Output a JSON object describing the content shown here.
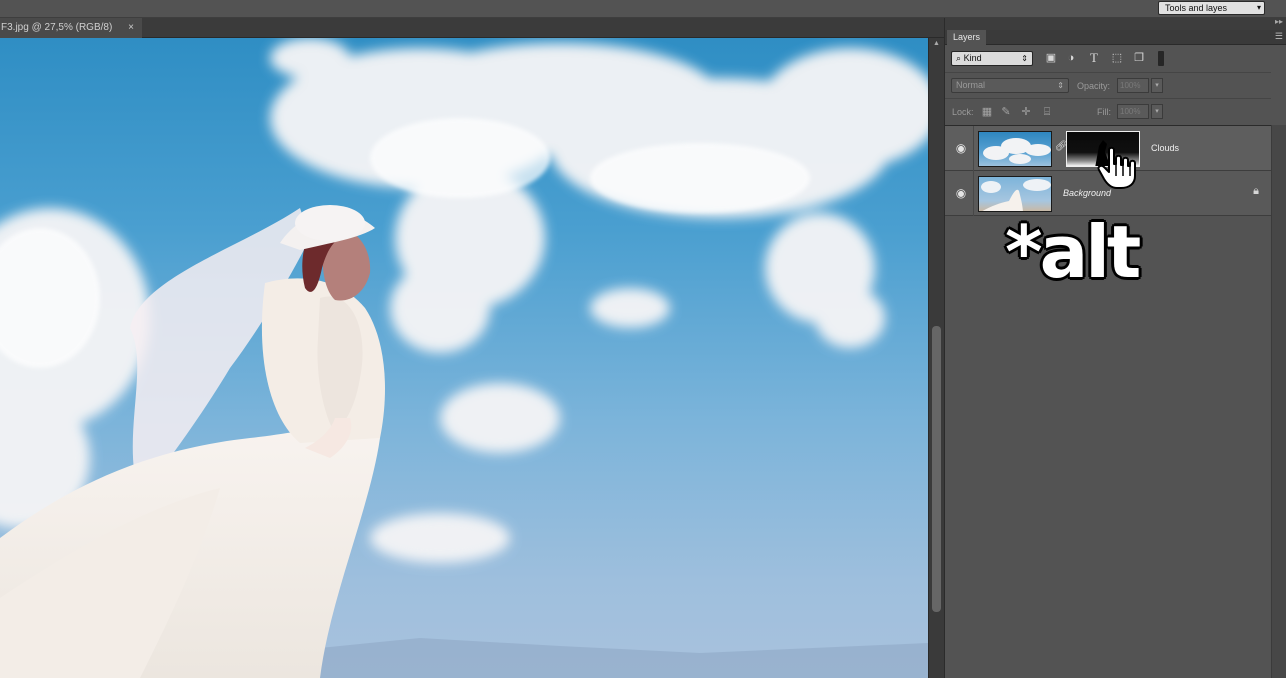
{
  "app": {
    "workspace": "Tools and layes",
    "document_tab": {
      "title": "F3.jpg @ 27,5% (RGB/8)",
      "close": "×"
    }
  },
  "layers_panel": {
    "tab_label": "Layers",
    "filter": {
      "kind_label": "Kind",
      "icons": [
        "pixel-filter-icon",
        "adjustment-filter-icon",
        "type-filter-icon",
        "shape-filter-icon",
        "smart-object-filter-icon"
      ]
    },
    "blend_mode": "Normal",
    "opacity_label": "Opacity:",
    "opacity_value": "100%",
    "lock_label": "Lock:",
    "lock_icons": [
      "lock-transparent-pixels-icon",
      "lock-image-pixels-icon",
      "lock-position-icon",
      "lock-all-icon"
    ],
    "fill_label": "Fill:",
    "fill_value": "100%",
    "layers": [
      {
        "name": "Clouds",
        "visible": true,
        "has_mask": true,
        "locked": false
      },
      {
        "name": "Background",
        "visible": true,
        "has_mask": false,
        "locked": true
      }
    ]
  },
  "overlay": {
    "caption": "*alt"
  },
  "colors": {
    "panel_bg": "#535353",
    "sky": "#4a9fd0"
  }
}
